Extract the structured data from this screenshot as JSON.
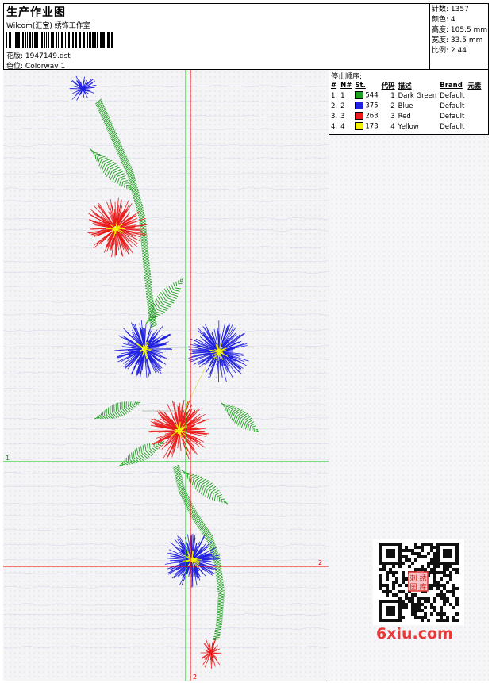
{
  "header": {
    "title": "生产作业图",
    "subtitle": "Wilcom(汇宝) 绣饰工作室",
    "design_label": "花版:",
    "design_value": "1947149.dst",
    "colorway_label": "色位:",
    "colorway_value": "Colorway 1"
  },
  "stats": [
    {
      "label": "针数:",
      "value": "1357"
    },
    {
      "label": "颜色:",
      "value": "4"
    },
    {
      "label": "高度:",
      "value": "105.5 mm"
    },
    {
      "label": "宽度:",
      "value": "33.5 mm"
    },
    {
      "label": "比例:",
      "value": "2.44"
    }
  ],
  "stop_sequence": {
    "title": "停止顺序:",
    "columns": [
      "#",
      "N#",
      "St.",
      "代码",
      "描述",
      "Brand",
      "元素"
    ],
    "rows": [
      {
        "idx": "1.",
        "n": "1",
        "color": "#1fa01f",
        "st": "544",
        "code": "1",
        "desc": "Dark Green",
        "brand": "Default",
        "elem": ""
      },
      {
        "idx": "2.",
        "n": "2",
        "color": "#2020e0",
        "st": "375",
        "code": "2",
        "desc": "Blue",
        "brand": "Default",
        "elem": ""
      },
      {
        "idx": "3.",
        "n": "3",
        "color": "#e81c1c",
        "st": "263",
        "code": "3",
        "desc": "Red",
        "brand": "Default",
        "elem": ""
      },
      {
        "idx": "4.",
        "n": "4",
        "color": "#f2f200",
        "st": "173",
        "code": "4",
        "desc": "Yellow",
        "brand": "Default",
        "elem": ""
      }
    ]
  },
  "guides": {
    "label_1_top": "1",
    "label_1_left": "1",
    "label_2_right": "2",
    "label_2_bottom": "2"
  },
  "watermark": "6xiu.com",
  "qr_stamp": "刺绣图库",
  "colors": {
    "green": "#1fa01f",
    "blue": "#2020e0",
    "red": "#e81c1c",
    "yellow": "#f2f200",
    "guide_green": "#00cc00",
    "guide_red": "#ff0000"
  }
}
